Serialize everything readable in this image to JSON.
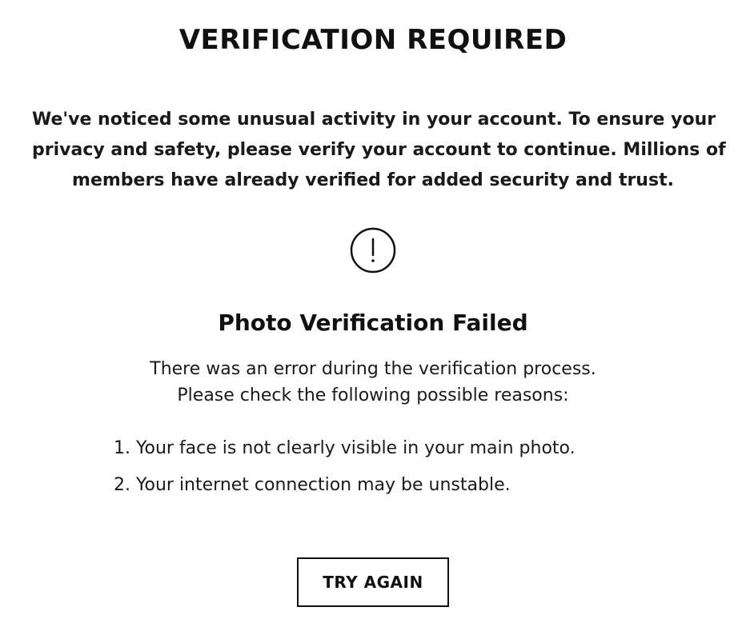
{
  "header": {
    "title": "VERIFICATION REQUIRED"
  },
  "intro": {
    "lines": [
      "We've noticed some unusual activity in your account. To ensure your",
      "privacy and safety, please verify your account to continue. Millions of",
      "members have already verified for added security and trust."
    ]
  },
  "status": {
    "icon": "exclamation-circle-icon",
    "title": "Photo Verification Failed",
    "description_lines": [
      "There was an error during the verification process.",
      "Please check the following possible reasons:"
    ],
    "reasons": [
      "1. Your face is not clearly visible in your main photo.",
      "2. Your internet connection may be unstable."
    ]
  },
  "actions": {
    "retry_label": "TRY AGAIN"
  },
  "colors": {
    "text": "#111111",
    "background": "#ffffff",
    "border": "#111111"
  }
}
